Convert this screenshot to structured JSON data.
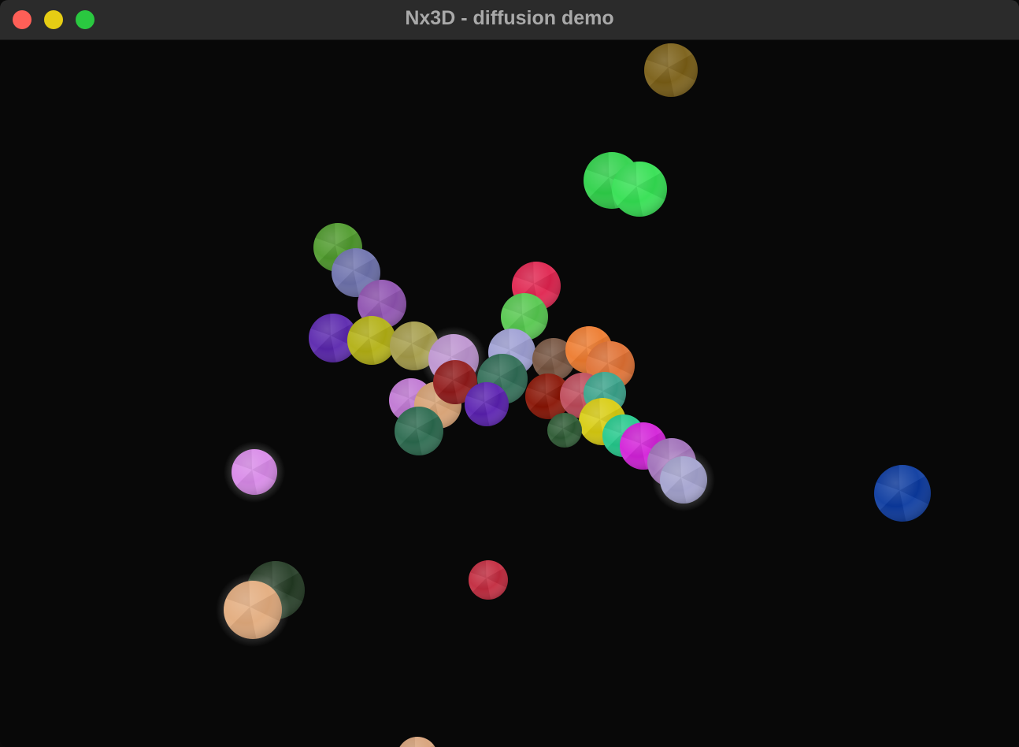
{
  "window": {
    "title": "Nx3D - diffusion demo",
    "controls": {
      "close_color": "#fe5f57",
      "minimize_color": "#e6cd14",
      "maximize_color": "#2ac840"
    }
  },
  "scene": {
    "background": "#080808",
    "spheres": [
      {
        "name": "sphere-olive-top",
        "color": "#7a5e16"
      },
      {
        "name": "sphere-green-bright-a",
        "color": "#2fd24a"
      },
      {
        "name": "sphere-green-bright-b",
        "color": "#33e052"
      },
      {
        "name": "sphere-green-leaf",
        "color": "#4e9a2c"
      },
      {
        "name": "sphere-slate-blue",
        "color": "#6e72ad"
      },
      {
        "name": "sphere-orchid",
        "color": "#8f52b0"
      },
      {
        "name": "sphere-indigo",
        "color": "#5a26ad"
      },
      {
        "name": "sphere-mustard",
        "color": "#b3b014"
      },
      {
        "name": "sphere-khaki",
        "color": "#a59c49"
      },
      {
        "name": "sphere-crimson",
        "color": "#e0234e"
      },
      {
        "name": "sphere-lime",
        "color": "#56c84f"
      },
      {
        "name": "sphere-lavender-a",
        "color": "#bd94d0"
      },
      {
        "name": "sphere-periwinkle",
        "color": "#9fa0d4"
      },
      {
        "name": "sphere-brown",
        "color": "#75533f"
      },
      {
        "name": "sphere-orange-a",
        "color": "#ee7b2e"
      },
      {
        "name": "sphere-orange-b",
        "color": "#e07032"
      },
      {
        "name": "sphere-violet-pink",
        "color": "#c078d3"
      },
      {
        "name": "sphere-peach-a",
        "color": "#d6a071"
      },
      {
        "name": "sphere-dark-red",
        "color": "#911a1a"
      },
      {
        "name": "sphere-teal-dark-a",
        "color": "#2f6c55"
      },
      {
        "name": "sphere-blue-violet",
        "color": "#5a20b0"
      },
      {
        "name": "sphere-maroon",
        "color": "#881404"
      },
      {
        "name": "sphere-rose",
        "color": "#be4a5a"
      },
      {
        "name": "sphere-teal",
        "color": "#3aa38b"
      },
      {
        "name": "sphere-yellow",
        "color": "#d9cd10"
      },
      {
        "name": "sphere-dark-green-small",
        "color": "#2d5a33"
      },
      {
        "name": "sphere-aqua",
        "color": "#24c98c"
      },
      {
        "name": "sphere-magenta",
        "color": "#d321d9"
      },
      {
        "name": "sphere-plum",
        "color": "#a06fb9"
      },
      {
        "name": "sphere-pale-lilac",
        "color": "#a4a3cf"
      },
      {
        "name": "sphere-teal-dark-b",
        "color": "#2b6a4e"
      },
      {
        "name": "sphere-lilac-left",
        "color": "#d88ae8"
      },
      {
        "name": "sphere-royal-blue",
        "color": "#0b3aa0"
      },
      {
        "name": "sphere-red-small",
        "color": "#c22a3e"
      },
      {
        "name": "sphere-forest",
        "color": "#223a23"
      },
      {
        "name": "sphere-peach-b",
        "color": "#e3ac7e"
      },
      {
        "name": "sphere-peach-bottom",
        "color": "#d7a27a"
      }
    ]
  }
}
